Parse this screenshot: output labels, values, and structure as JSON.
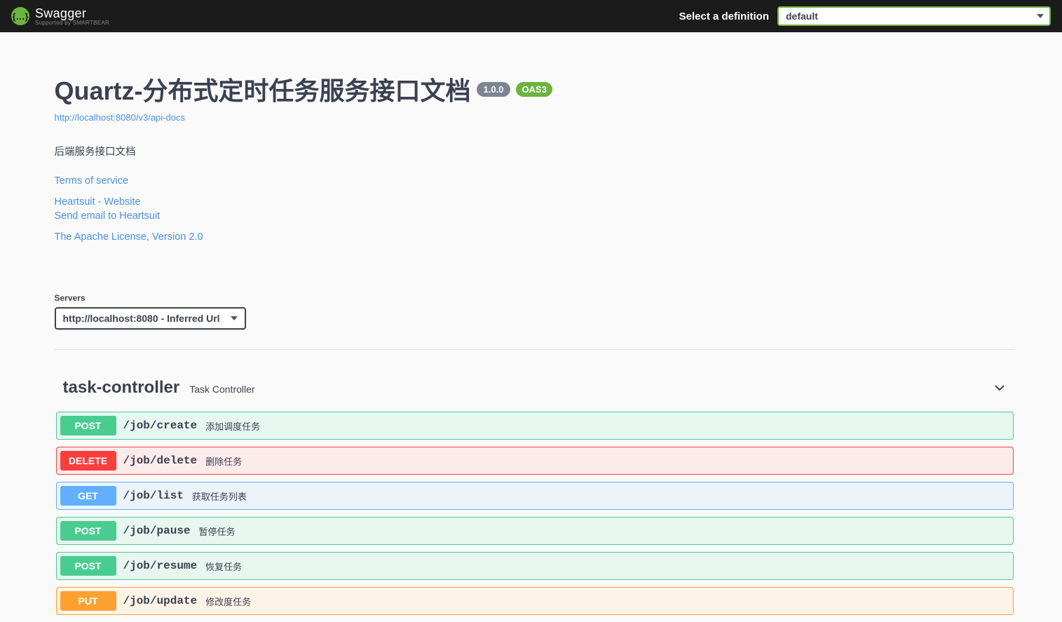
{
  "topbar": {
    "brand": "Swagger",
    "supported": "Supported by SMARTBEAR",
    "select_label": "Select a definition",
    "definition": "default"
  },
  "info": {
    "title": "Quartz-分布式定时任务服务接口文档",
    "version": "1.0.0",
    "oas": "OAS3",
    "url": "http://localhost:8080/v3/api-docs",
    "description": "后端服务接口文档",
    "terms": "Terms of service",
    "contact_site": "Heartsuit - Website",
    "contact_email": "Send email to Heartsuit",
    "license": "The Apache License, Version 2.0"
  },
  "servers": {
    "label": "Servers",
    "selected": "http://localhost:8080 - Inferred Url"
  },
  "tag": {
    "name": "task-controller",
    "description": "Task Controller"
  },
  "operations": [
    {
      "method": "POST",
      "path": "/job/create",
      "summary": "添加调度任务",
      "cls": "post"
    },
    {
      "method": "DELETE",
      "path": "/job/delete",
      "summary": "删除任务",
      "cls": "delete"
    },
    {
      "method": "GET",
      "path": "/job/list",
      "summary": "获取任务列表",
      "cls": "get"
    },
    {
      "method": "POST",
      "path": "/job/pause",
      "summary": "暂停任务",
      "cls": "post"
    },
    {
      "method": "POST",
      "path": "/job/resume",
      "summary": "恢复任务",
      "cls": "post"
    },
    {
      "method": "PUT",
      "path": "/job/update",
      "summary": "修改度任务",
      "cls": "put"
    }
  ]
}
